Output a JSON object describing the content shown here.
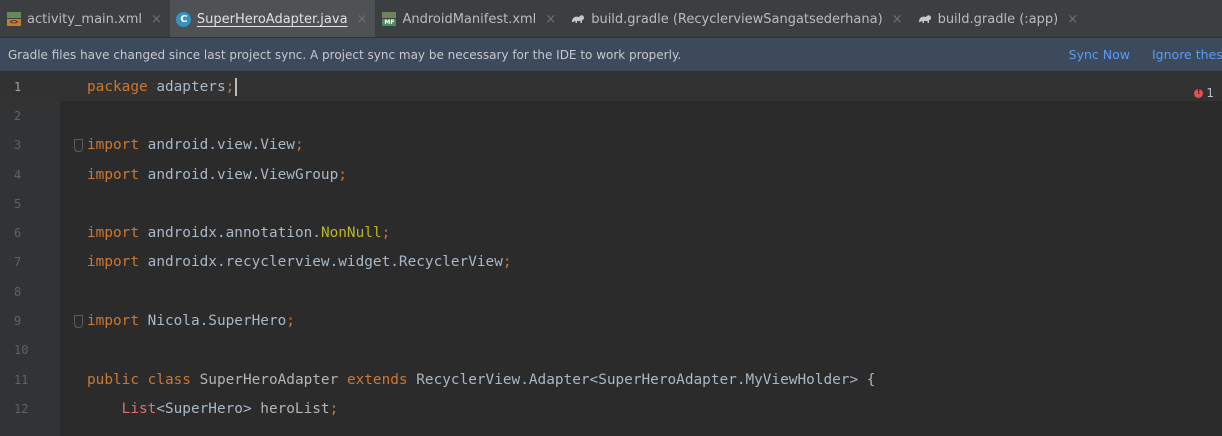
{
  "tabs": [
    {
      "label": "activity_main.xml",
      "icon": "layout-xml-icon",
      "active": false
    },
    {
      "label": "SuperHeroAdapter.java",
      "icon": "java-class-icon",
      "active": true
    },
    {
      "label": "AndroidManifest.xml",
      "icon": "manifest-icon",
      "active": false
    },
    {
      "label": "build.gradle (RecyclerviewSangatsederhana)",
      "icon": "gradle-elephant-icon",
      "active": false
    },
    {
      "label": "build.gradle (:app)",
      "icon": "gradle-elephant-icon",
      "active": false
    }
  ],
  "tab_close": "×",
  "icon_text": {
    "class_letter": "C",
    "layout_badge": "<>",
    "manifest_badge": "MF"
  },
  "banner": {
    "message": "Gradle files have changed since last project sync. A project sync may be necessary for the IDE to work properly.",
    "sync_now": "Sync Now",
    "ignore": "Ignore these changes"
  },
  "inspection": {
    "error_count": "1"
  },
  "editor": {
    "lines": [
      {
        "n": "1",
        "tokens": [
          {
            "t": "package ",
            "c": "kw"
          },
          {
            "t": "adapters",
            "c": "plain"
          },
          {
            "t": ";",
            "c": "kw"
          }
        ]
      },
      {
        "n": "2",
        "tokens": []
      },
      {
        "n": "3",
        "tokens": [
          {
            "t": "import ",
            "c": "kw"
          },
          {
            "t": "android.view.View",
            "c": "plain"
          },
          {
            "t": ";",
            "c": "kw"
          }
        ]
      },
      {
        "n": "4",
        "tokens": [
          {
            "t": "import ",
            "c": "kw"
          },
          {
            "t": "android.view.ViewGroup",
            "c": "plain"
          },
          {
            "t": ";",
            "c": "kw"
          }
        ]
      },
      {
        "n": "5",
        "tokens": []
      },
      {
        "n": "6",
        "tokens": [
          {
            "t": "import ",
            "c": "kw"
          },
          {
            "t": "androidx.annotation.",
            "c": "plain"
          },
          {
            "t": "NonNull",
            "c": "ann"
          },
          {
            "t": ";",
            "c": "kw"
          }
        ]
      },
      {
        "n": "7",
        "tokens": [
          {
            "t": "import ",
            "c": "kw"
          },
          {
            "t": "androidx.recyclerview.widget.RecyclerView",
            "c": "plain"
          },
          {
            "t": ";",
            "c": "kw"
          }
        ]
      },
      {
        "n": "8",
        "tokens": []
      },
      {
        "n": "9",
        "tokens": [
          {
            "t": "import ",
            "c": "kw"
          },
          {
            "t": "Nicola.SuperHero",
            "c": "plain"
          },
          {
            "t": ";",
            "c": "kw"
          }
        ]
      },
      {
        "n": "10",
        "tokens": []
      },
      {
        "n": "11",
        "tokens": [
          {
            "t": "public class ",
            "c": "kw"
          },
          {
            "t": "SuperHeroAdapter ",
            "c": "dim"
          },
          {
            "t": "extends ",
            "c": "kw"
          },
          {
            "t": "RecyclerView.Adapter<SuperHeroAdapter.MyViewHolder> {",
            "c": "plain"
          }
        ]
      },
      {
        "n": "12",
        "tokens": [
          {
            "t": "    List",
            "c": "red"
          },
          {
            "t": "<SuperHero> ",
            "c": "plain"
          },
          {
            "t": "heroList",
            "c": "dim"
          },
          {
            "t": ";",
            "c": "kw"
          }
        ]
      }
    ]
  }
}
